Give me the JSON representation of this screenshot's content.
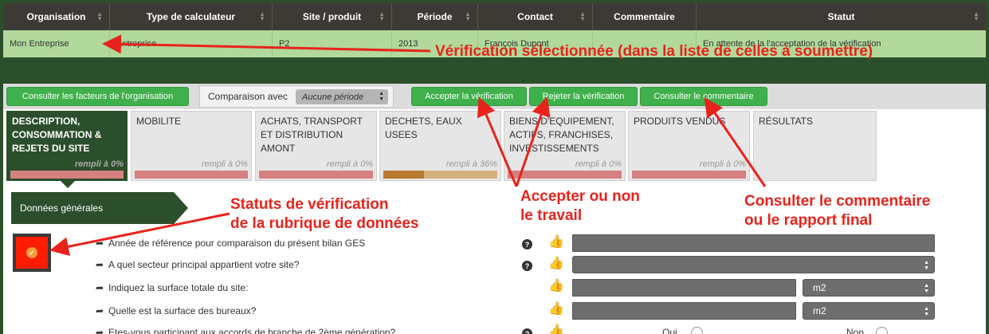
{
  "table": {
    "headers": [
      "Organisation",
      "Type de calculateur",
      "Site / produit",
      "Période",
      "Contact",
      "Commentaire",
      "Statut"
    ],
    "row": [
      "Mon Entreprise",
      "Entreprise",
      "P2",
      "2013",
      "François Dupont",
      "",
      "En attente de la l'acceptation de la vérification"
    ]
  },
  "toolbar": {
    "consult_factors": "Consulter les facteurs de l'organisation",
    "compare_label": "Comparaison avec",
    "compare_value": "Aucune période",
    "accept": "Accepter la vérification",
    "reject": "Rejeter la vérification",
    "comment": "Consulter le commentaire"
  },
  "categories": [
    {
      "label": "DESCRIPTION, CONSOMMATION & REJETS DU SITE",
      "fill": "rempli à 0%",
      "progress": 0,
      "active": true
    },
    {
      "label": "MOBILITE",
      "fill": "rempli à 0%",
      "progress": 0
    },
    {
      "label": "ACHATS, TRANSPORT ET DISTRIBUTION AMONT",
      "fill": "rempli à 0%",
      "progress": 0
    },
    {
      "label": "DECHETS, EAUX USEES",
      "fill": "rempli à 36%",
      "progress": 0.36
    },
    {
      "label": "BIENS D'EQUIPEMENT, ACTIFS, FRANCHISES, INVESTISSEMENTS",
      "fill": "rempli à 0%",
      "progress": 0
    },
    {
      "label": "PRODUITS VENDUS",
      "fill": "rempli à 0%",
      "progress": 0
    },
    {
      "label": "RÉSULTATS",
      "fill": "",
      "progress": 0
    }
  ],
  "section": {
    "title": "Données générales"
  },
  "questions": [
    "Année de référence pour comparaison du présent bilan GES",
    "A quel secteur principal appartient votre site?",
    "Indiquez la surface totale du site:",
    "Quelle est la surface des bureaux?",
    "Etes-vous participant aux accords de branche de 2ème génération?"
  ],
  "units": {
    "surface_total": "m2",
    "surface_bureaux": "m2"
  },
  "radio": {
    "yes": "Oui",
    "no": "Non"
  },
  "annotations": {
    "selected": "Vérification sélectionnée (dans la liste de celles à soumettre)",
    "status_line1": "Statuts de vérification",
    "status_line2": "de la rubrique de données",
    "accept_line1": "Accepter ou non",
    "accept_line2": "le travail",
    "comment_line1": "Consulter le commentaire",
    "comment_line2": "ou le rapport final"
  },
  "colors": {
    "brand_dark": "#2c4f2b",
    "button_green": "#3fb04c",
    "annotation_red": "#e8231b",
    "selected_row": "#b1d99b"
  },
  "icons": [
    "sort-icon",
    "select-arrow-icon",
    "help-icon",
    "thumbs-up-icon",
    "share-arrow-icon",
    "check-icon"
  ]
}
